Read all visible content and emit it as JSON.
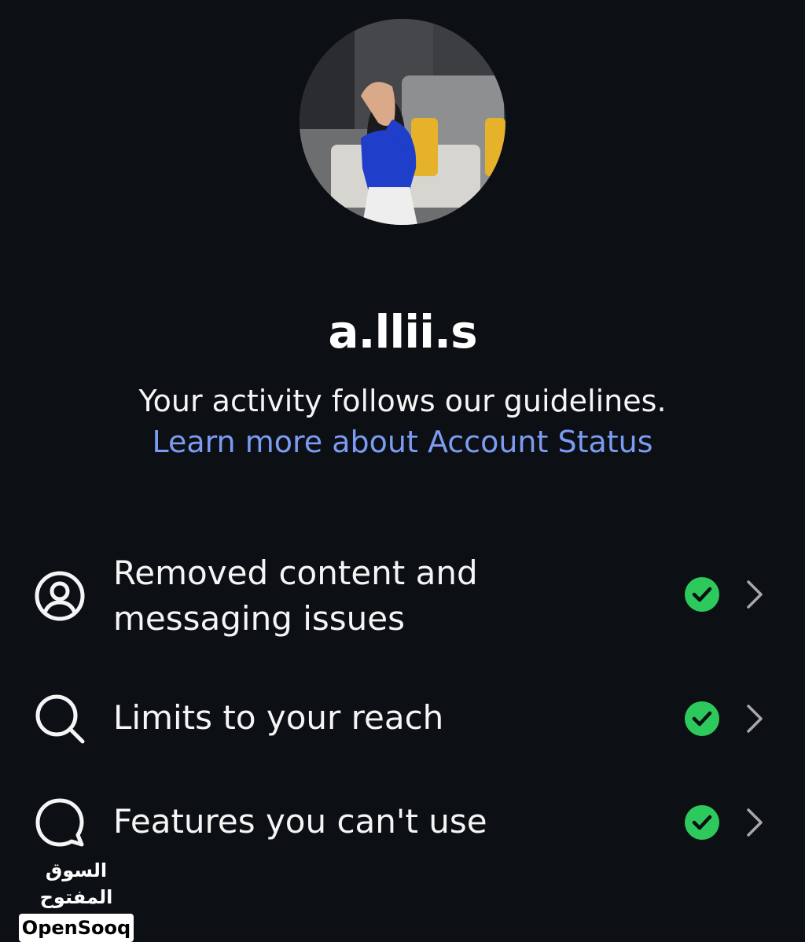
{
  "profile": {
    "username": "a.llii.s",
    "status_text": "Your activity follows our guidelines.",
    "status_link": "Learn more about Account Status"
  },
  "items": [
    {
      "label_line1": "Removed content and",
      "label_line2": "messaging issues",
      "icon": "user-circle-icon",
      "status": "ok"
    },
    {
      "label_line1": "Limits to your reach",
      "icon": "search-icon",
      "status": "ok"
    },
    {
      "label_line1": "Features you can't use",
      "icon": "speech-bubble-icon",
      "status": "ok"
    }
  ],
  "colors": {
    "background": "#0c1014",
    "link": "#7c9bf2",
    "check": "#2ec95c"
  },
  "watermark": {
    "arabic": "السوق المفتوح",
    "latin": "OpenSooq"
  }
}
